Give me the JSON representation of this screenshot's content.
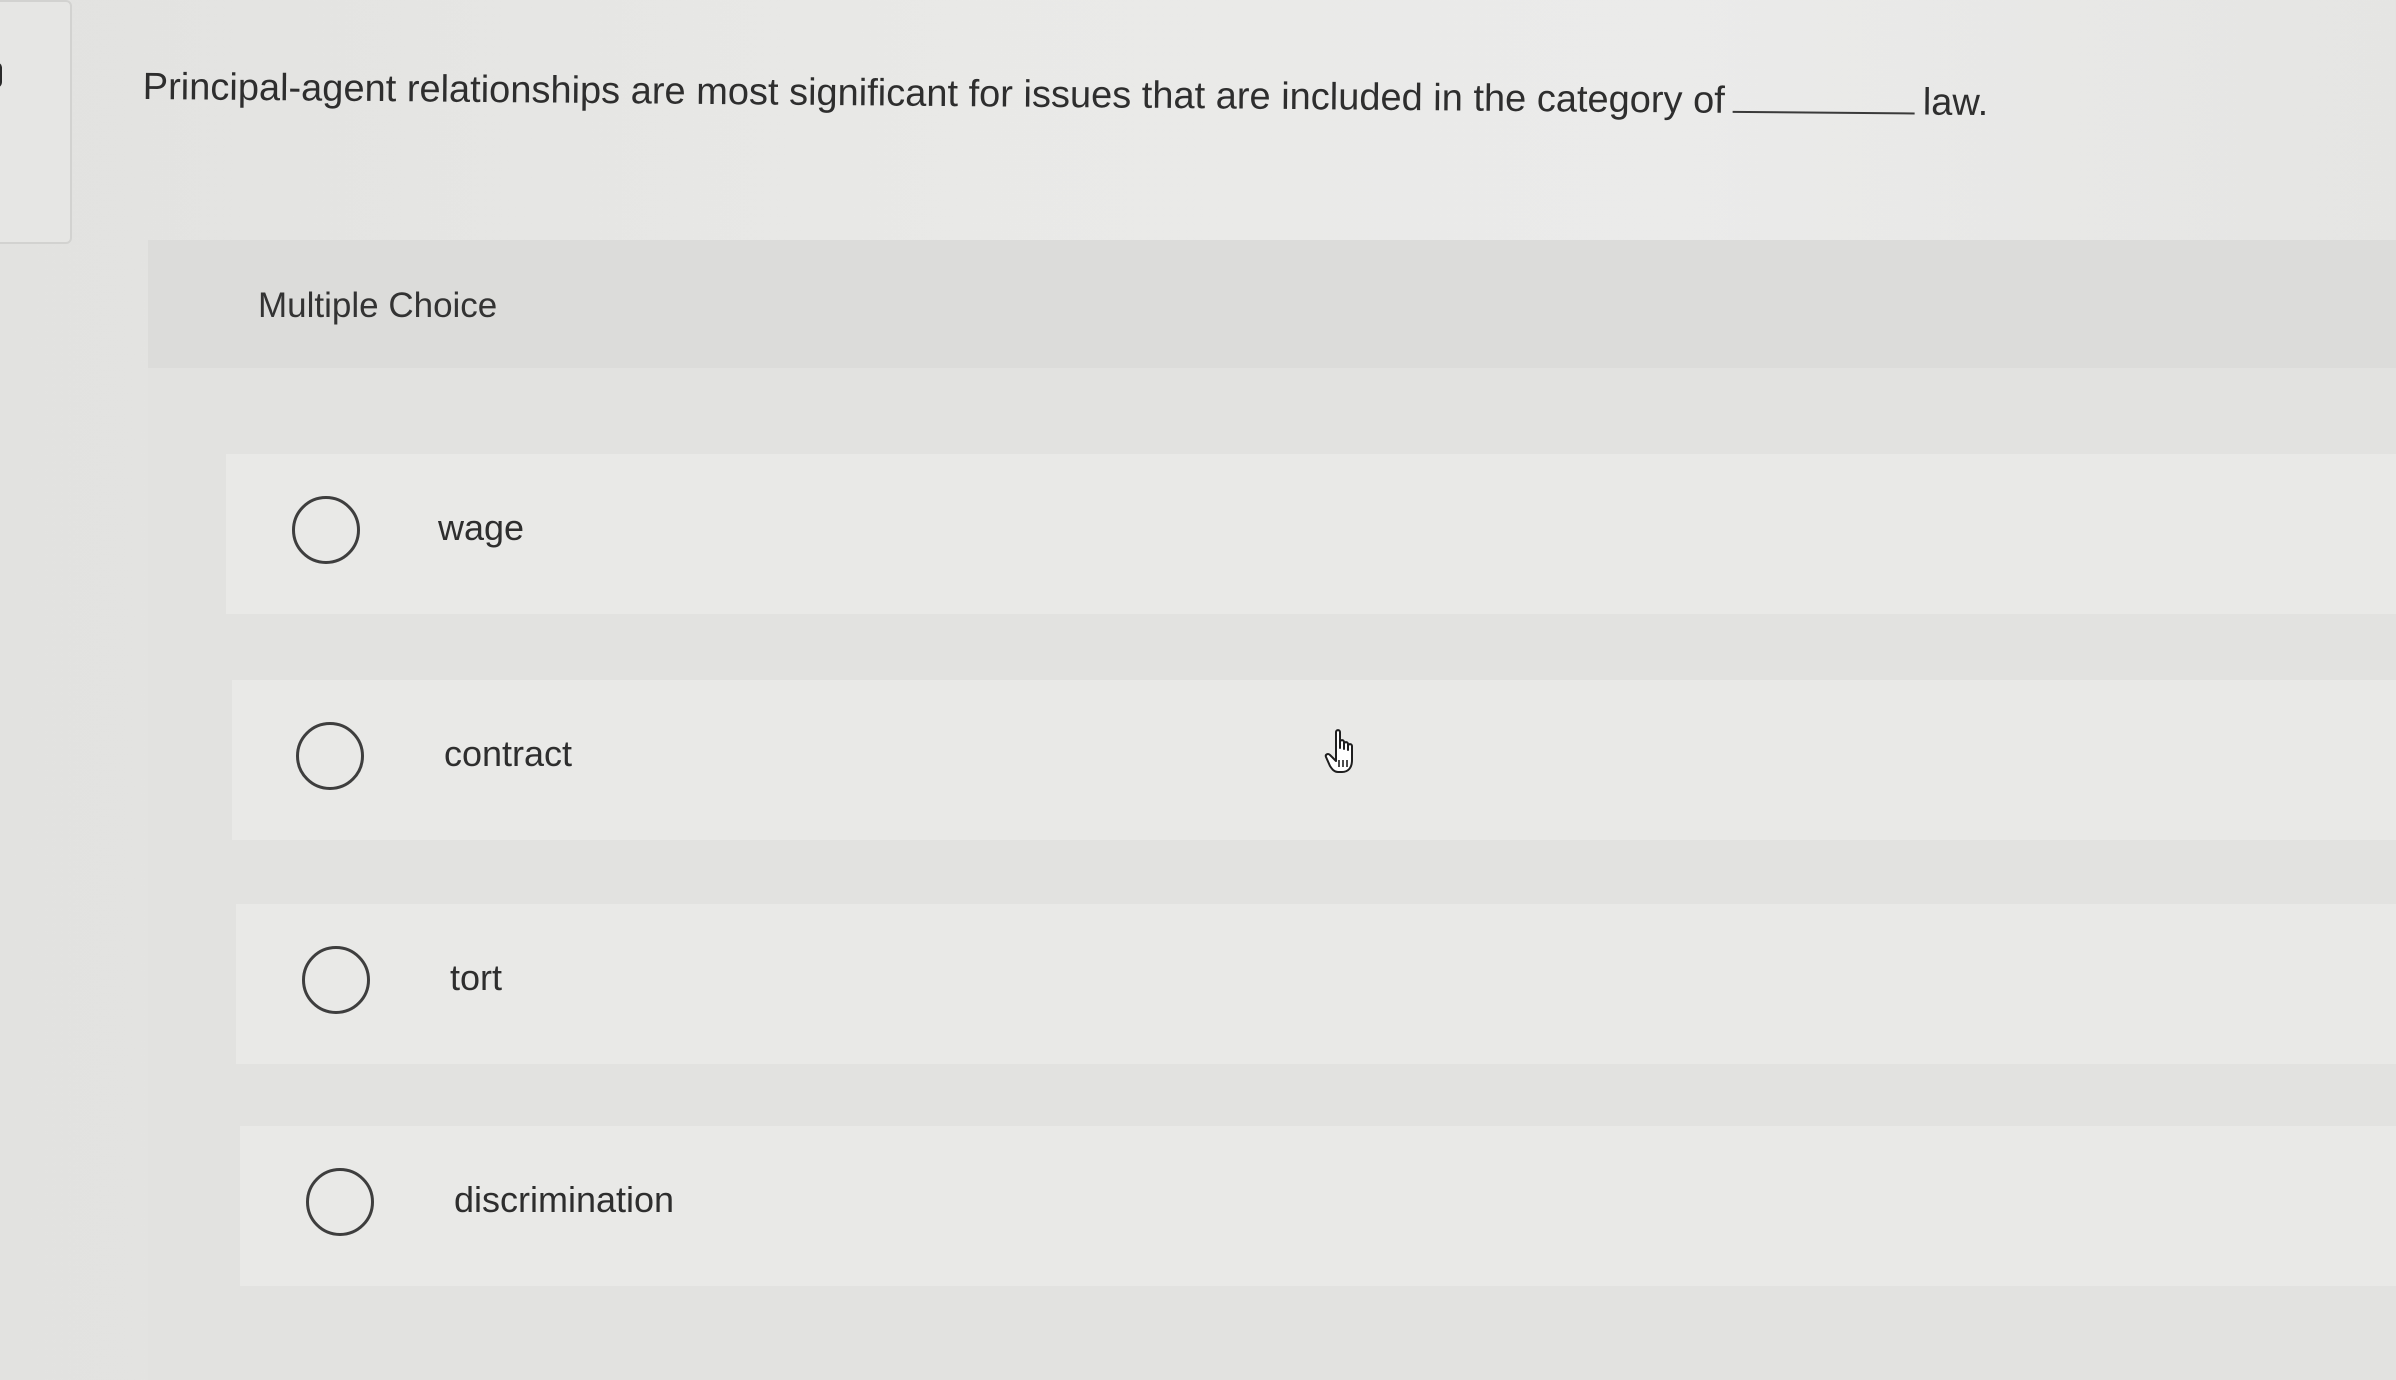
{
  "question": {
    "text_before": "Principal-agent relationships are most significant for issues that are included in the category of",
    "text_after": "law."
  },
  "multiple_choice": {
    "title": "Multiple Choice",
    "options": [
      {
        "label": "wage"
      },
      {
        "label": "contract"
      },
      {
        "label": "tort"
      },
      {
        "label": "discrimination"
      }
    ]
  },
  "icons": {
    "radio": "radio-circle-icon",
    "cursor": "hand-pointer-icon"
  },
  "colors": {
    "background": "#e9e9e7",
    "header_band": "#dcdcda",
    "text": "#2e2e2e",
    "radio_stroke": "#3e3e3e"
  }
}
